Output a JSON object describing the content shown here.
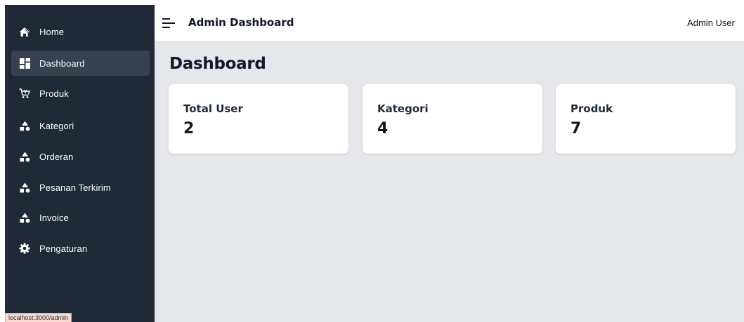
{
  "sidebar": {
    "items": [
      {
        "label": "Home",
        "icon": "home-icon",
        "active": false
      },
      {
        "label": "Dashboard",
        "icon": "dashboard-icon",
        "active": true
      },
      {
        "label": "Produk",
        "icon": "cart-icon",
        "active": false
      },
      {
        "label": "Kategori",
        "icon": "shapes-icon",
        "active": false
      },
      {
        "label": "Orderan",
        "icon": "shapes-icon",
        "active": false
      },
      {
        "label": "Pesanan Terkirim",
        "icon": "shapes-icon",
        "active": false
      },
      {
        "label": "Invoice",
        "icon": "shapes-icon",
        "active": false
      },
      {
        "label": "Pengaturan",
        "icon": "gear-icon",
        "active": false
      }
    ]
  },
  "topbar": {
    "title": "Admin Dashboard",
    "user": "Admin User"
  },
  "main": {
    "title": "Dashboard",
    "cards": [
      {
        "label": "Total User",
        "value": "2"
      },
      {
        "label": "Kategori",
        "value": "4"
      },
      {
        "label": "Produk",
        "value": "7"
      }
    ]
  },
  "status_url": "localhost:3000/admin",
  "colors": {
    "sidebar_bg": "#1f2937",
    "sidebar_active": "#374151",
    "content_bg": "#e5e7eb",
    "card_bg": "#ffffff"
  }
}
